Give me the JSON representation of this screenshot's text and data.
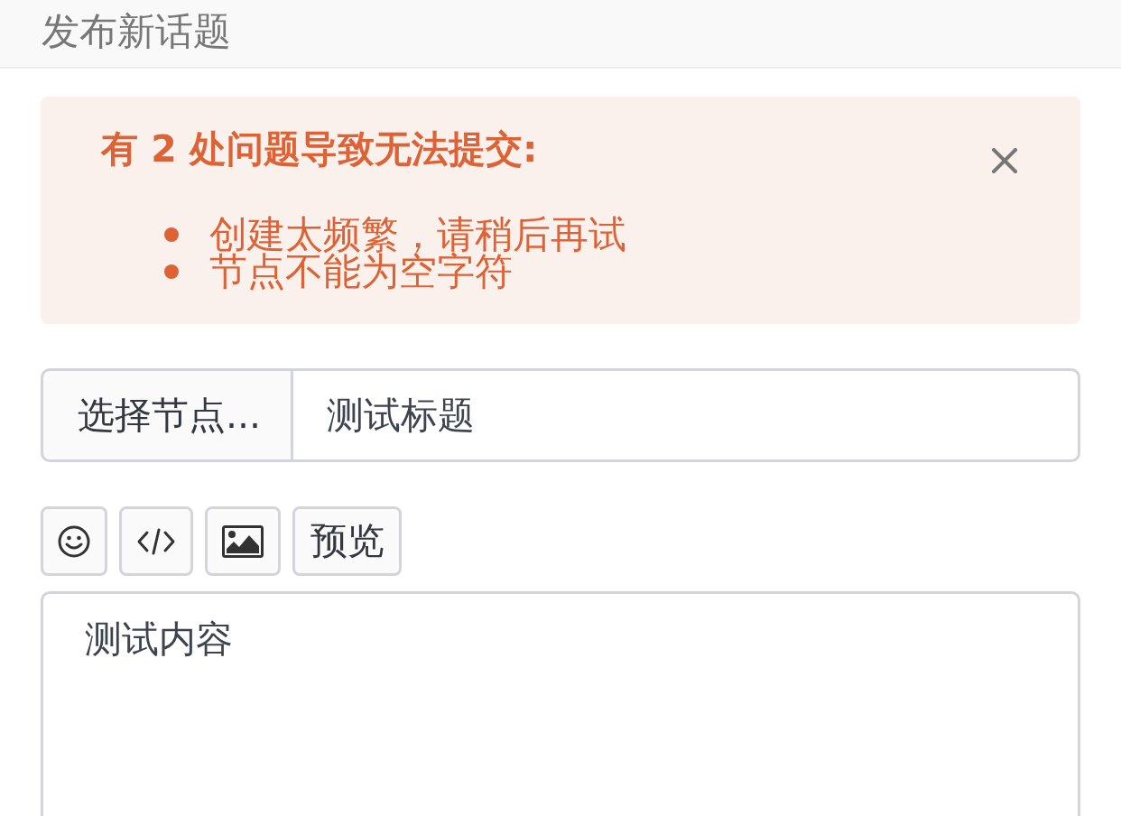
{
  "header": {
    "title": "发布新话题"
  },
  "alert": {
    "title": "有 2 处问题导致无法提交:",
    "errors": [
      "创建太频繁，请稍后再试",
      "节点不能为空字符"
    ],
    "dismissible": true
  },
  "title_row": {
    "node_picker": {
      "label": "选择节点..."
    },
    "title_input": {
      "value": "测试标题"
    }
  },
  "toolbar": [
    {
      "kind": "emoji"
    },
    {
      "kind": "code"
    },
    {
      "kind": "image"
    },
    {
      "kind": "preview",
      "label": "预览"
    }
  ],
  "content_editor": {
    "value": "测试内容"
  }
}
